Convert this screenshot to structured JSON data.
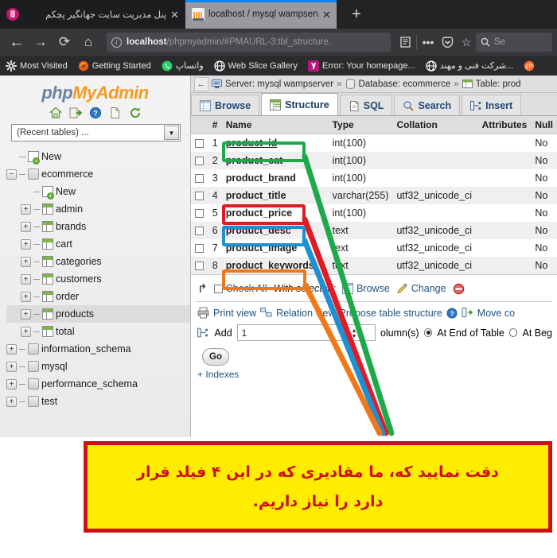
{
  "browser": {
    "tabs": [
      {
        "title": "پنل مدیریت سایت جهانگیر پچکم",
        "favicon": "pink-site-icon",
        "active": false
      },
      {
        "title": "localhost / mysql wampserver / ec",
        "favicon": "phpmyadmin-icon",
        "active": true
      }
    ],
    "new_tab_label": "+",
    "nav": {
      "back_icon": "←",
      "forward_icon": "→",
      "reload_icon": "⟳",
      "home_icon": "⌂",
      "url_host": "localhost",
      "url_path": "/phpmyadmin/#PMAURL-3:tbl_structure.",
      "reader_icon": "reader-view-icon",
      "menu_icon": "•••",
      "pocket_icon": "pocket-icon",
      "star_icon": "☆",
      "search_placeholder": "Se"
    },
    "bookmarks": [
      {
        "label": "Most Visited",
        "icon": "gear-icon"
      },
      {
        "label": "Getting Started",
        "icon": "firefox-icon"
      },
      {
        "label": "واتساپ",
        "icon": "whatsapp-icon"
      },
      {
        "label": "Web Slice Gallery",
        "icon": "globe-icon"
      },
      {
        "label": "Error: Your homepage...",
        "icon": "yandex-icon"
      },
      {
        "label": "شرکت فنی و مهند...",
        "icon": "globe-icon"
      },
      {
        "label": "",
        "icon": "cpanel-icon"
      }
    ]
  },
  "sidebar": {
    "logo_php": "php",
    "logo_myadmin": "MyAdmin",
    "logo_icons": [
      "home-icon",
      "logout-icon",
      "help-icon",
      "docs-icon",
      "reload-icon"
    ],
    "recent_tables_label": "(Recent tables) ...",
    "tree": [
      {
        "label": "New",
        "depth": 0,
        "kind": "new",
        "toggle": "none",
        "selected": false
      },
      {
        "label": "ecommerce",
        "depth": 0,
        "kind": "db",
        "toggle": "minus",
        "selected": false
      },
      {
        "label": "New",
        "depth": 1,
        "kind": "new",
        "toggle": "none",
        "selected": false
      },
      {
        "label": "admin",
        "depth": 1,
        "kind": "table",
        "toggle": "plus",
        "selected": false
      },
      {
        "label": "brands",
        "depth": 1,
        "kind": "table",
        "toggle": "plus",
        "selected": false
      },
      {
        "label": "cart",
        "depth": 1,
        "kind": "table",
        "toggle": "plus",
        "selected": false
      },
      {
        "label": "categories",
        "depth": 1,
        "kind": "table",
        "toggle": "plus",
        "selected": false
      },
      {
        "label": "customers",
        "depth": 1,
        "kind": "table",
        "toggle": "plus",
        "selected": false
      },
      {
        "label": "order",
        "depth": 1,
        "kind": "table",
        "toggle": "plus",
        "selected": false
      },
      {
        "label": "products",
        "depth": 1,
        "kind": "table",
        "toggle": "plus",
        "selected": true
      },
      {
        "label": "total",
        "depth": 1,
        "kind": "table",
        "toggle": "plus",
        "selected": false
      },
      {
        "label": "information_schema",
        "depth": 0,
        "kind": "db",
        "toggle": "plus",
        "selected": false
      },
      {
        "label": "mysql",
        "depth": 0,
        "kind": "db",
        "toggle": "plus",
        "selected": false
      },
      {
        "label": "performance_schema",
        "depth": 0,
        "kind": "db",
        "toggle": "plus",
        "selected": false
      },
      {
        "label": "test",
        "depth": 0,
        "kind": "db",
        "toggle": "plus",
        "selected": false
      }
    ]
  },
  "breadcrumb": {
    "server_label": "Server: mysql wampserver",
    "database_label": "Database: ecommerce",
    "table_label": "Table: prod",
    "separator": "»"
  },
  "main_tabs": [
    {
      "label": "Browse",
      "icon": "browse-icon",
      "active": false
    },
    {
      "label": "Structure",
      "icon": "structure-icon",
      "active": true
    },
    {
      "label": "SQL",
      "icon": "sql-icon",
      "active": false
    },
    {
      "label": "Search",
      "icon": "search-icon",
      "active": false
    },
    {
      "label": "Insert",
      "icon": "insert-icon",
      "active": false
    }
  ],
  "structure_table": {
    "headers": [
      "#",
      "Name",
      "Type",
      "Collation",
      "Attributes",
      "Null"
    ],
    "rows": [
      {
        "num": "1",
        "name": "product_id",
        "type": "int(100)",
        "collation": "",
        "attributes": "",
        "null": "No",
        "primary": true,
        "highlight": "green"
      },
      {
        "num": "2",
        "name": "product_cat",
        "type": "int(100)",
        "collation": "",
        "attributes": "",
        "null": "No",
        "primary": false,
        "highlight": ""
      },
      {
        "num": "3",
        "name": "product_brand",
        "type": "int(100)",
        "collation": "",
        "attributes": "",
        "null": "No",
        "primary": false,
        "highlight": ""
      },
      {
        "num": "4",
        "name": "product_title",
        "type": "varchar(255)",
        "collation": "utf32_unicode_ci",
        "attributes": "",
        "null": "No",
        "primary": false,
        "highlight": "red"
      },
      {
        "num": "5",
        "name": "product_price",
        "type": "int(100)",
        "collation": "",
        "attributes": "",
        "null": "No",
        "primary": false,
        "highlight": "blue"
      },
      {
        "num": "6",
        "name": "product_desc",
        "type": "text",
        "collation": "utf32_unicode_ci",
        "attributes": "",
        "null": "No",
        "primary": false,
        "highlight": ""
      },
      {
        "num": "7",
        "name": "product_image",
        "type": "text",
        "collation": "utf32_unicode_ci",
        "attributes": "",
        "null": "No",
        "primary": false,
        "highlight": "orange"
      },
      {
        "num": "8",
        "name": "product_keywords",
        "type": "text",
        "collation": "utf32_unicode_ci",
        "attributes": "",
        "null": "No",
        "primary": false,
        "highlight": ""
      }
    ]
  },
  "actions": {
    "check_all": "Check All",
    "with_selected": "With selected:",
    "browse": "Browse",
    "change": "Change",
    "drop_icon": "drop-icon"
  },
  "links_row": {
    "print_view": "Print view",
    "relation_view": "Relation view",
    "propose": "Propose table structure",
    "help_icon": "help-icon",
    "move_columns": "Move co"
  },
  "add_row": {
    "add_label": "Add",
    "count_value": "1",
    "columns_label": "olumn(s)",
    "at_end": "At End of Table",
    "at_beginning": "At Beg",
    "go_label": "Go",
    "indexes_label": "+ Indexes"
  },
  "callout": {
    "line1": "دقت نمایید که، ما مقادیری که در این ۴ فیلد قرار",
    "line2": "دارد را نیاز داریم."
  },
  "colors": {
    "green": "#1eaa4b",
    "red": "#e01b24",
    "blue": "#1e90d2",
    "orange": "#f07818",
    "callout_bg": "#ffec00",
    "callout_border": "#cc1111",
    "callout_text": "#cc1111",
    "accent_link": "#22527d"
  }
}
